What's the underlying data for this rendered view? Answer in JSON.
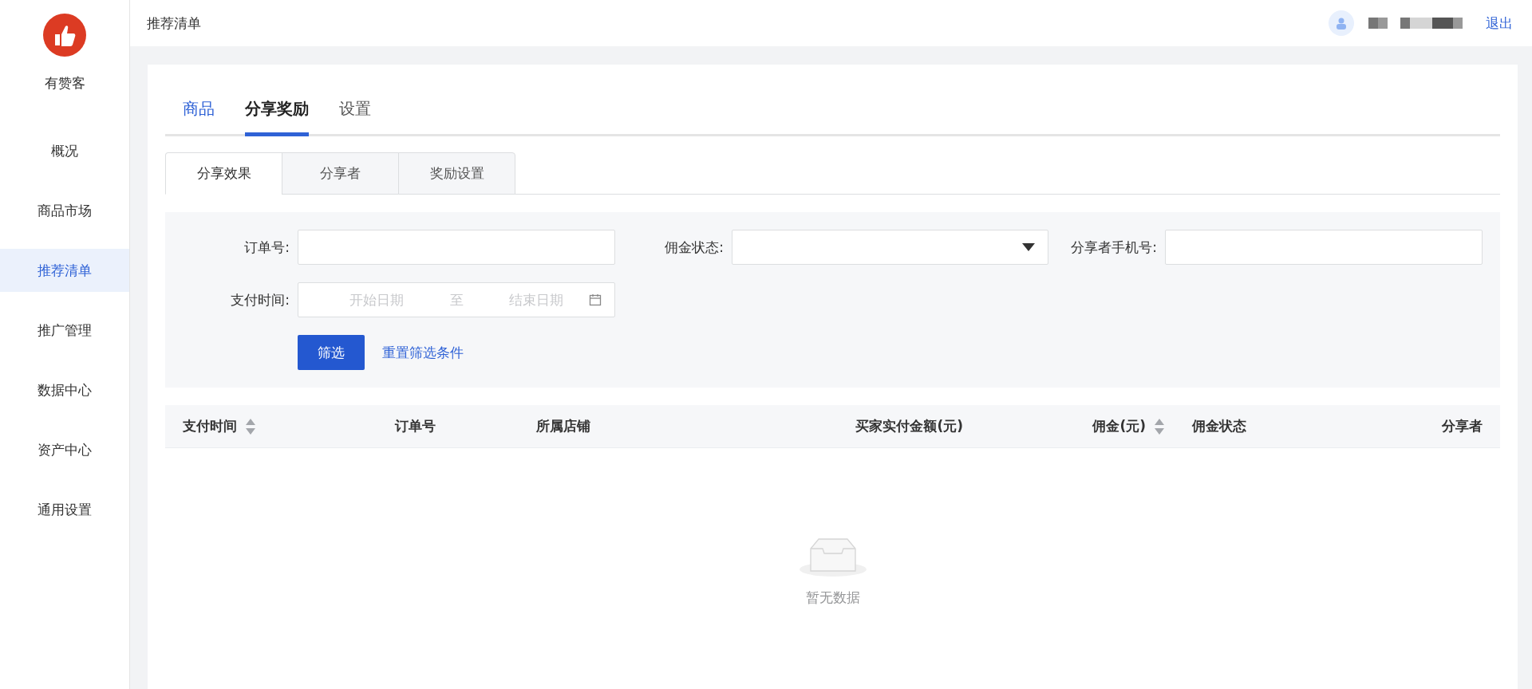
{
  "sidebar": {
    "brand": "有赞客",
    "items": [
      {
        "label": "概况",
        "selected": false
      },
      {
        "label": "商品市场",
        "selected": false
      },
      {
        "label": "推荐清单",
        "selected": true
      },
      {
        "label": "推广管理",
        "selected": false
      },
      {
        "label": "数据中心",
        "selected": false
      },
      {
        "label": "资产中心",
        "selected": false
      },
      {
        "label": "通用设置",
        "selected": false
      }
    ]
  },
  "header": {
    "title": "推荐清单",
    "logout": "退出"
  },
  "tabs": [
    {
      "label": "商品",
      "selected": false,
      "highlighted": true
    },
    {
      "label": "分享奖励",
      "selected": true,
      "highlighted": false
    },
    {
      "label": "设置",
      "selected": false,
      "highlighted": false
    }
  ],
  "sub_tabs": [
    {
      "label": "分享效果",
      "selected": true
    },
    {
      "label": "分享者",
      "selected": false
    },
    {
      "label": "奖励设置",
      "selected": false
    }
  ],
  "filters": {
    "order_no": {
      "label": "订单号:"
    },
    "commission_status": {
      "label": "佣金状态:"
    },
    "sharer_phone": {
      "label": "分享者手机号:"
    },
    "pay_time": {
      "label": "支付时间:",
      "start_placeholder": "开始日期",
      "separator": "至",
      "end_placeholder": "结束日期"
    },
    "filter_button": "筛选",
    "reset_link": "重置筛选条件"
  },
  "table": {
    "columns": [
      {
        "label": "支付时间",
        "kind": "sortable"
      },
      {
        "label": "订单号",
        "kind": "plain"
      },
      {
        "label": "所属店铺",
        "kind": "plain"
      },
      {
        "label": "买家实付金额(元)",
        "kind": "plain"
      },
      {
        "label": "佣金(元)",
        "kind": "sortable"
      },
      {
        "label": "佣金状态",
        "kind": "plain"
      },
      {
        "label": "分享者",
        "kind": "plain"
      }
    ],
    "empty_text": "暂无数据"
  }
}
